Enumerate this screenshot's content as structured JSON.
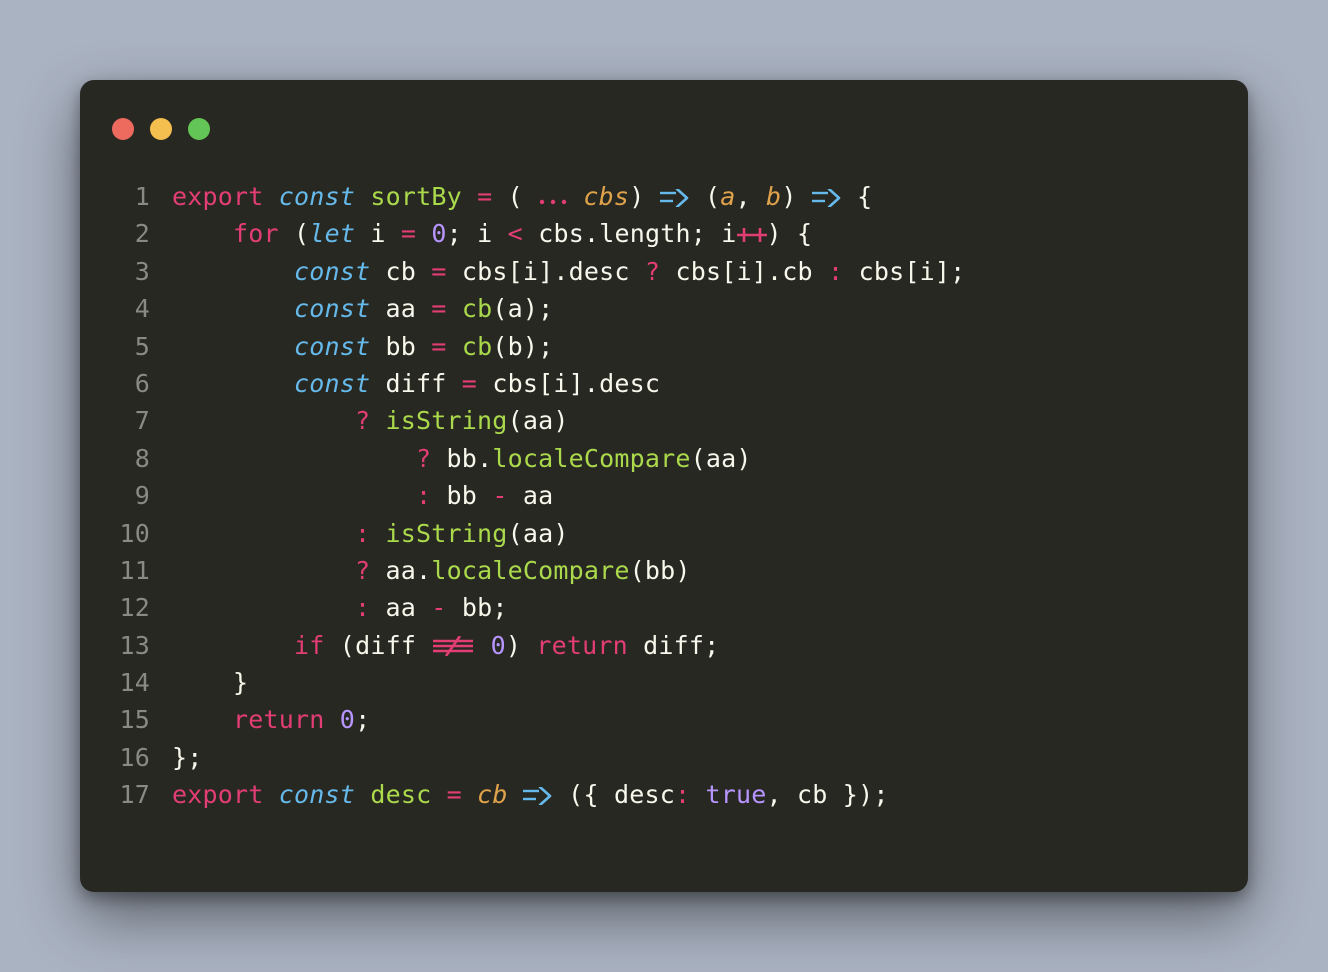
{
  "code": {
    "lines": [
      {
        "n": "1",
        "tokens": [
          {
            "c": "kw",
            "t": "export"
          },
          {
            "c": "txt",
            "t": " "
          },
          {
            "c": "decl",
            "t": "const"
          },
          {
            "c": "txt",
            "t": " "
          },
          {
            "c": "fn",
            "t": "sortBy"
          },
          {
            "c": "txt",
            "t": " "
          },
          {
            "c": "op",
            "t": "="
          },
          {
            "c": "txt",
            "t": " "
          },
          {
            "c": "punc",
            "t": "("
          },
          {
            "c": "txt",
            "t": " "
          },
          {
            "c": "spread",
            "t": "..."
          },
          {
            "c": "txt",
            "t": " "
          },
          {
            "c": "param",
            "t": "cbs"
          },
          {
            "c": "punc",
            "t": ")"
          },
          {
            "c": "txt",
            "t": " "
          },
          {
            "c": "arrow",
            "t": "ARROW"
          },
          {
            "c": "txt",
            "t": " "
          },
          {
            "c": "punc",
            "t": "("
          },
          {
            "c": "param",
            "t": "a"
          },
          {
            "c": "punc",
            "t": ","
          },
          {
            "c": "txt",
            "t": " "
          },
          {
            "c": "param",
            "t": "b"
          },
          {
            "c": "punc",
            "t": ")"
          },
          {
            "c": "txt",
            "t": " "
          },
          {
            "c": "arrow",
            "t": "ARROW"
          },
          {
            "c": "txt",
            "t": " "
          },
          {
            "c": "punc",
            "t": "{"
          }
        ]
      },
      {
        "n": "2",
        "tokens": [
          {
            "c": "txt",
            "t": "    "
          },
          {
            "c": "kw",
            "t": "for"
          },
          {
            "c": "txt",
            "t": " "
          },
          {
            "c": "punc",
            "t": "("
          },
          {
            "c": "decl",
            "t": "let"
          },
          {
            "c": "txt",
            "t": " i "
          },
          {
            "c": "op",
            "t": "="
          },
          {
            "c": "txt",
            "t": " "
          },
          {
            "c": "num",
            "t": "0"
          },
          {
            "c": "punc",
            "t": ";"
          },
          {
            "c": "txt",
            "t": " i "
          },
          {
            "c": "op",
            "t": "<"
          },
          {
            "c": "txt",
            "t": " cbs"
          },
          {
            "c": "punc",
            "t": "."
          },
          {
            "c": "prop",
            "t": "length"
          },
          {
            "c": "punc",
            "t": ";"
          },
          {
            "c": "txt",
            "t": " i"
          },
          {
            "c": "inc",
            "t": "PLUSPLUS"
          },
          {
            "c": "punc",
            "t": ")"
          },
          {
            "c": "txt",
            "t": " "
          },
          {
            "c": "punc",
            "t": "{"
          }
        ]
      },
      {
        "n": "3",
        "tokens": [
          {
            "c": "txt",
            "t": "        "
          },
          {
            "c": "decl",
            "t": "const"
          },
          {
            "c": "txt",
            "t": " cb "
          },
          {
            "c": "op",
            "t": "="
          },
          {
            "c": "txt",
            "t": " cbs"
          },
          {
            "c": "punc",
            "t": "["
          },
          {
            "c": "txt",
            "t": "i"
          },
          {
            "c": "punc",
            "t": "]"
          },
          {
            "c": "punc",
            "t": "."
          },
          {
            "c": "prop",
            "t": "desc"
          },
          {
            "c": "txt",
            "t": " "
          },
          {
            "c": "op",
            "t": "?"
          },
          {
            "c": "txt",
            "t": " cbs"
          },
          {
            "c": "punc",
            "t": "["
          },
          {
            "c": "txt",
            "t": "i"
          },
          {
            "c": "punc",
            "t": "]"
          },
          {
            "c": "punc",
            "t": "."
          },
          {
            "c": "prop",
            "t": "cb"
          },
          {
            "c": "txt",
            "t": " "
          },
          {
            "c": "op",
            "t": ":"
          },
          {
            "c": "txt",
            "t": " cbs"
          },
          {
            "c": "punc",
            "t": "["
          },
          {
            "c": "txt",
            "t": "i"
          },
          {
            "c": "punc",
            "t": "]"
          },
          {
            "c": "punc",
            "t": ";"
          }
        ]
      },
      {
        "n": "4",
        "tokens": [
          {
            "c": "txt",
            "t": "        "
          },
          {
            "c": "decl",
            "t": "const"
          },
          {
            "c": "txt",
            "t": " aa "
          },
          {
            "c": "op",
            "t": "="
          },
          {
            "c": "txt",
            "t": " "
          },
          {
            "c": "fn",
            "t": "cb"
          },
          {
            "c": "punc",
            "t": "("
          },
          {
            "c": "txt",
            "t": "a"
          },
          {
            "c": "punc",
            "t": ")"
          },
          {
            "c": "punc",
            "t": ";"
          }
        ]
      },
      {
        "n": "5",
        "tokens": [
          {
            "c": "txt",
            "t": "        "
          },
          {
            "c": "decl",
            "t": "const"
          },
          {
            "c": "txt",
            "t": " bb "
          },
          {
            "c": "op",
            "t": "="
          },
          {
            "c": "txt",
            "t": " "
          },
          {
            "c": "fn",
            "t": "cb"
          },
          {
            "c": "punc",
            "t": "("
          },
          {
            "c": "txt",
            "t": "b"
          },
          {
            "c": "punc",
            "t": ")"
          },
          {
            "c": "punc",
            "t": ";"
          }
        ]
      },
      {
        "n": "6",
        "tokens": [
          {
            "c": "txt",
            "t": "        "
          },
          {
            "c": "decl",
            "t": "const"
          },
          {
            "c": "txt",
            "t": " diff "
          },
          {
            "c": "op",
            "t": "="
          },
          {
            "c": "txt",
            "t": " cbs"
          },
          {
            "c": "punc",
            "t": "["
          },
          {
            "c": "txt",
            "t": "i"
          },
          {
            "c": "punc",
            "t": "]"
          },
          {
            "c": "punc",
            "t": "."
          },
          {
            "c": "prop",
            "t": "desc"
          }
        ]
      },
      {
        "n": "7",
        "tokens": [
          {
            "c": "txt",
            "t": "            "
          },
          {
            "c": "op",
            "t": "?"
          },
          {
            "c": "txt",
            "t": " "
          },
          {
            "c": "fn",
            "t": "isString"
          },
          {
            "c": "punc",
            "t": "("
          },
          {
            "c": "txt",
            "t": "aa"
          },
          {
            "c": "punc",
            "t": ")"
          }
        ]
      },
      {
        "n": "8",
        "tokens": [
          {
            "c": "txt",
            "t": "                "
          },
          {
            "c": "op",
            "t": "?"
          },
          {
            "c": "txt",
            "t": " bb"
          },
          {
            "c": "punc",
            "t": "."
          },
          {
            "c": "fn",
            "t": "localeCompare"
          },
          {
            "c": "punc",
            "t": "("
          },
          {
            "c": "txt",
            "t": "aa"
          },
          {
            "c": "punc",
            "t": ")"
          }
        ]
      },
      {
        "n": "9",
        "tokens": [
          {
            "c": "txt",
            "t": "                "
          },
          {
            "c": "op",
            "t": ":"
          },
          {
            "c": "txt",
            "t": " bb "
          },
          {
            "c": "op",
            "t": "-"
          },
          {
            "c": "txt",
            "t": " aa"
          }
        ]
      },
      {
        "n": "10",
        "tokens": [
          {
            "c": "txt",
            "t": "            "
          },
          {
            "c": "op",
            "t": ":"
          },
          {
            "c": "txt",
            "t": " "
          },
          {
            "c": "fn",
            "t": "isString"
          },
          {
            "c": "punc",
            "t": "("
          },
          {
            "c": "txt",
            "t": "aa"
          },
          {
            "c": "punc",
            "t": ")"
          }
        ]
      },
      {
        "n": "11",
        "tokens": [
          {
            "c": "txt",
            "t": "            "
          },
          {
            "c": "op",
            "t": "?"
          },
          {
            "c": "txt",
            "t": " aa"
          },
          {
            "c": "punc",
            "t": "."
          },
          {
            "c": "fn",
            "t": "localeCompare"
          },
          {
            "c": "punc",
            "t": "("
          },
          {
            "c": "txt",
            "t": "bb"
          },
          {
            "c": "punc",
            "t": ")"
          }
        ]
      },
      {
        "n": "12",
        "tokens": [
          {
            "c": "txt",
            "t": "            "
          },
          {
            "c": "op",
            "t": ":"
          },
          {
            "c": "txt",
            "t": " aa "
          },
          {
            "c": "op",
            "t": "-"
          },
          {
            "c": "txt",
            "t": " bb"
          },
          {
            "c": "punc",
            "t": ";"
          }
        ]
      },
      {
        "n": "13",
        "tokens": [
          {
            "c": "txt",
            "t": "        "
          },
          {
            "c": "kw",
            "t": "if"
          },
          {
            "c": "txt",
            "t": " "
          },
          {
            "c": "punc",
            "t": "("
          },
          {
            "c": "txt",
            "t": "diff "
          },
          {
            "c": "op",
            "t": "NEQ"
          },
          {
            "c": "txt",
            "t": " "
          },
          {
            "c": "num",
            "t": "0"
          },
          {
            "c": "punc",
            "t": ")"
          },
          {
            "c": "txt",
            "t": " "
          },
          {
            "c": "kw",
            "t": "return"
          },
          {
            "c": "txt",
            "t": " diff"
          },
          {
            "c": "punc",
            "t": ";"
          }
        ]
      },
      {
        "n": "14",
        "tokens": [
          {
            "c": "txt",
            "t": "    "
          },
          {
            "c": "punc",
            "t": "}"
          }
        ]
      },
      {
        "n": "15",
        "tokens": [
          {
            "c": "txt",
            "t": "    "
          },
          {
            "c": "kw",
            "t": "return"
          },
          {
            "c": "txt",
            "t": " "
          },
          {
            "c": "num",
            "t": "0"
          },
          {
            "c": "punc",
            "t": ";"
          }
        ]
      },
      {
        "n": "16",
        "tokens": [
          {
            "c": "punc",
            "t": "}"
          },
          {
            "c": "punc",
            "t": ";"
          }
        ]
      },
      {
        "n": "17",
        "tokens": [
          {
            "c": "kw",
            "t": "export"
          },
          {
            "c": "txt",
            "t": " "
          },
          {
            "c": "decl",
            "t": "const"
          },
          {
            "c": "txt",
            "t": " "
          },
          {
            "c": "fn",
            "t": "desc"
          },
          {
            "c": "txt",
            "t": " "
          },
          {
            "c": "op",
            "t": "="
          },
          {
            "c": "txt",
            "t": " "
          },
          {
            "c": "param",
            "t": "cb"
          },
          {
            "c": "txt",
            "t": " "
          },
          {
            "c": "arrow",
            "t": "ARROW"
          },
          {
            "c": "txt",
            "t": " "
          },
          {
            "c": "punc",
            "t": "("
          },
          {
            "c": "punc",
            "t": "{"
          },
          {
            "c": "txt",
            "t": " desc"
          },
          {
            "c": "op",
            "t": ":"
          },
          {
            "c": "txt",
            "t": " "
          },
          {
            "c": "bool",
            "t": "true"
          },
          {
            "c": "punc",
            "t": ","
          },
          {
            "c": "txt",
            "t": " cb "
          },
          {
            "c": "punc",
            "t": "}"
          },
          {
            "c": "punc",
            "t": ")"
          },
          {
            "c": "punc",
            "t": ";"
          }
        ]
      }
    ]
  }
}
